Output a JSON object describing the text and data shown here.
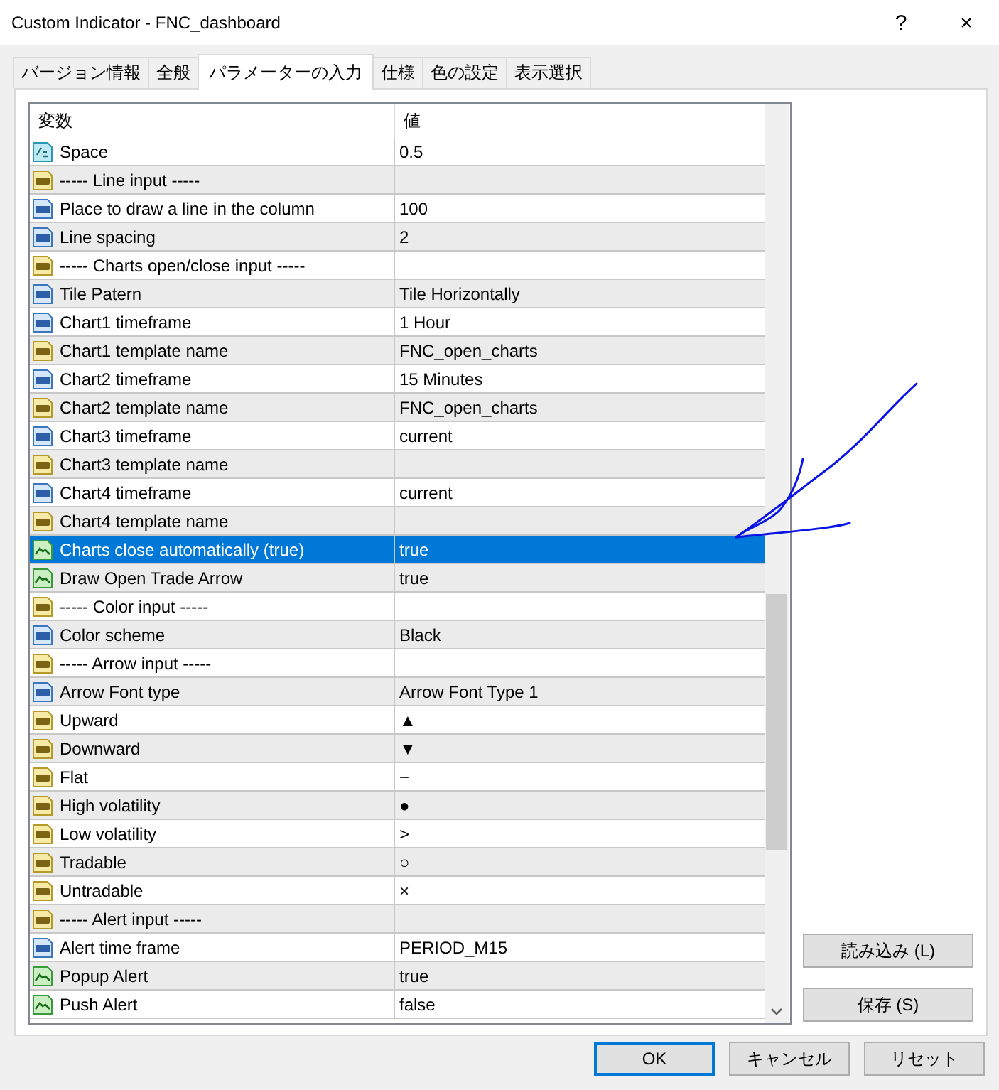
{
  "window": {
    "title": "Custom Indicator - FNC_dashboard",
    "help": "?",
    "close": "×"
  },
  "tabs": [
    {
      "label": "バージョン情報",
      "selected": false
    },
    {
      "label": "全般",
      "selected": false
    },
    {
      "label": "パラメーターの入力",
      "selected": true
    },
    {
      "label": "仕様",
      "selected": false
    },
    {
      "label": "色の設定",
      "selected": false
    },
    {
      "label": "表示選択",
      "selected": false
    }
  ],
  "table": {
    "columns": [
      "変数",
      "値"
    ],
    "rows": [
      {
        "kind": "double",
        "name": "Space",
        "value": "0.5",
        "selected": false
      },
      {
        "kind": "string",
        "name": "----- Line input -----",
        "value": "",
        "selected": false
      },
      {
        "kind": "int",
        "name": "Place to draw a line in the column",
        "value": "100",
        "selected": false
      },
      {
        "kind": "int",
        "name": "Line spacing",
        "value": "2",
        "selected": false
      },
      {
        "kind": "string",
        "name": "----- Charts open/close input -----",
        "value": "",
        "selected": false
      },
      {
        "kind": "int",
        "name": "Tile Patern",
        "value": "Tile Horizontally",
        "selected": false
      },
      {
        "kind": "int",
        "name": "Chart1 timeframe",
        "value": "1 Hour",
        "selected": false
      },
      {
        "kind": "string",
        "name": "Chart1 template name",
        "value": "FNC_open_charts",
        "selected": false
      },
      {
        "kind": "int",
        "name": "Chart2 timeframe",
        "value": "15 Minutes",
        "selected": false
      },
      {
        "kind": "string",
        "name": "Chart2 template name",
        "value": "FNC_open_charts",
        "selected": false
      },
      {
        "kind": "int",
        "name": "Chart3 timeframe",
        "value": "current",
        "selected": false
      },
      {
        "kind": "string",
        "name": "Chart3 template name",
        "value": "",
        "selected": false
      },
      {
        "kind": "int",
        "name": "Chart4 timeframe",
        "value": "current",
        "selected": false
      },
      {
        "kind": "string",
        "name": "Chart4 template name",
        "value": "",
        "selected": false
      },
      {
        "kind": "bool",
        "name": "Charts close automatically (true)",
        "value": "true",
        "selected": true
      },
      {
        "kind": "bool",
        "name": "Draw Open Trade Arrow",
        "value": "true",
        "selected": false
      },
      {
        "kind": "string",
        "name": "----- Color input -----",
        "value": "",
        "selected": false
      },
      {
        "kind": "int",
        "name": "Color scheme",
        "value": "Black",
        "selected": false
      },
      {
        "kind": "string",
        "name": "----- Arrow input -----",
        "value": "",
        "selected": false
      },
      {
        "kind": "int",
        "name": "Arrow Font type",
        "value": "Arrow Font Type 1",
        "selected": false
      },
      {
        "kind": "string",
        "name": "Upward",
        "value": "▲",
        "selected": false
      },
      {
        "kind": "string",
        "name": "Downward",
        "value": "▼",
        "selected": false
      },
      {
        "kind": "string",
        "name": "Flat",
        "value": "−",
        "selected": false
      },
      {
        "kind": "string",
        "name": "High volatility",
        "value": "●",
        "selected": false
      },
      {
        "kind": "string",
        "name": "Low volatility",
        "value": ">",
        "selected": false
      },
      {
        "kind": "string",
        "name": "Tradable",
        "value": "○",
        "selected": false
      },
      {
        "kind": "string",
        "name": "Untradable",
        "value": "×",
        "selected": false
      },
      {
        "kind": "string",
        "name": "----- Alert input -----",
        "value": "",
        "selected": false
      },
      {
        "kind": "int",
        "name": "Alert time frame",
        "value": "PERIOD_M15",
        "selected": false
      },
      {
        "kind": "bool",
        "name": "Popup Alert",
        "value": "true",
        "selected": false
      },
      {
        "kind": "bool",
        "name": "Push Alert",
        "value": "false",
        "selected": false
      }
    ]
  },
  "side_buttons": [
    "読み込み (L)",
    "保存 (S)"
  ],
  "buttons": [
    {
      "label": "OK",
      "default": true
    },
    {
      "label": "キャンセル",
      "default": false
    },
    {
      "label": "リセット",
      "default": false
    }
  ]
}
